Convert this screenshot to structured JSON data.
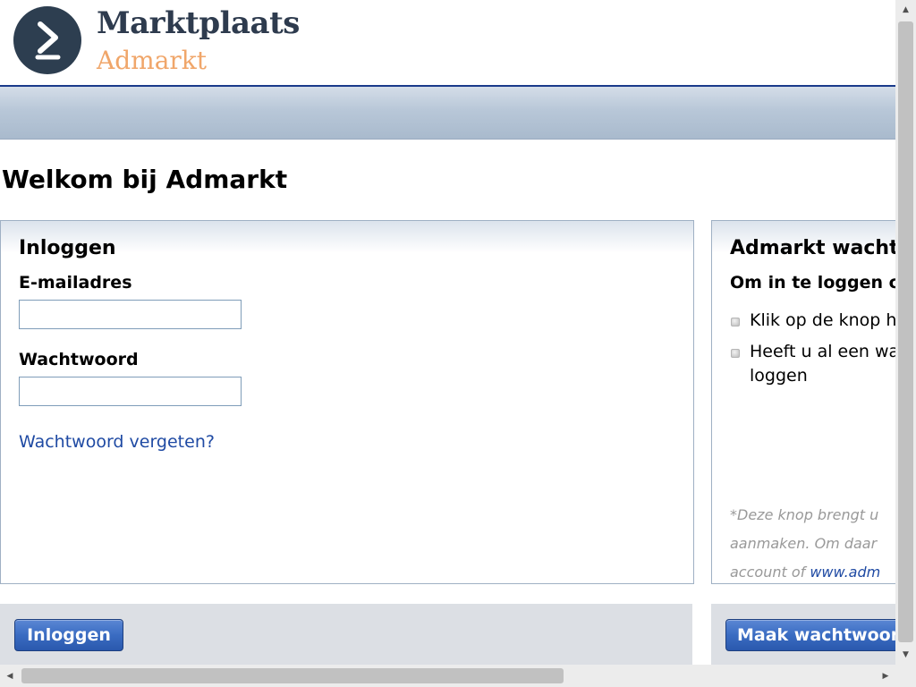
{
  "header": {
    "brand_name": "Marktplaats",
    "brand_sub": "Admarkt",
    "logo_icon": "marktplaats-admarkt-logo",
    "colors": {
      "brand_dark": "#2e3b4e",
      "brand_accent": "#f0a66a",
      "rule": "#1a3a8a"
    }
  },
  "page": {
    "title": "Welkom bij Admarkt"
  },
  "login_panel": {
    "heading": "Inloggen",
    "email_label": "E-mailadres",
    "email_value": "",
    "password_label": "Wachtwoord",
    "password_value": "",
    "forgot_link": "Wachtwoord vergeten?",
    "submit_label": "Inloggen"
  },
  "password_panel": {
    "heading": "Admarkt wacht",
    "subheading": "Om in te loggen c",
    "bullets": [
      {
        "lines": [
          "Klik op de knop h"
        ]
      },
      {
        "lines": [
          "Heeft u al een wa",
          "loggen"
        ]
      }
    ],
    "note": {
      "line1": "*Deze knop brengt u",
      "line2": "aanmaken. Om daar",
      "line3_prefix": "account of ",
      "line3_link": "www.adm"
    },
    "button_label": "Maak wachtwoor"
  },
  "scrollbars": {
    "vertical_position": 0,
    "horizontal_position": 0
  },
  "colors": {
    "link": "#1f4aa3",
    "button": "#3a6cc2",
    "panel_border": "#9fb0c4",
    "footer_bg": "#dcdfe4"
  }
}
